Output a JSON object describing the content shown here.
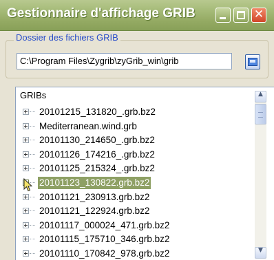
{
  "window": {
    "title": "Gestionnaire d'affichage GRIB",
    "close_glyph": "✕"
  },
  "folder_group": {
    "legend": "Dossier des fichiers GRIB",
    "path_value": "C:\\Program Files\\Zygrib\\zyGrib_win\\grib",
    "browse_icon": "folder-browse-icon"
  },
  "tree": {
    "root_label": "GRIBs",
    "items": [
      {
        "label": "20101215_131820_.grb.bz2",
        "selected": false
      },
      {
        "label": "Mediterranean.wind.grb",
        "selected": false
      },
      {
        "label": "20101130_214650_.grb.bz2",
        "selected": false
      },
      {
        "label": "20101126_174216_.grb.bz2",
        "selected": false
      },
      {
        "label": "20101125_215324_.grb.bz2",
        "selected": false
      },
      {
        "label": "20101123_130822.grb.bz2",
        "selected": true
      },
      {
        "label": "20101121_230913.grb.bz2",
        "selected": false
      },
      {
        "label": "20101121_122924.grb.bz2",
        "selected": false
      },
      {
        "label": "20101117_000024_471.grb.bz2",
        "selected": false
      },
      {
        "label": "20101115_175710_346.grb.bz2",
        "selected": false
      },
      {
        "label": "20101110_170842_978.grb.bz2",
        "selected": false
      }
    ]
  },
  "scrollbar": {
    "up_glyph": "▲",
    "down_glyph": "▼"
  },
  "colors": {
    "titlebar": "#94aa63",
    "selection": "#8ea064",
    "legend_text": "#2a4ec9"
  }
}
